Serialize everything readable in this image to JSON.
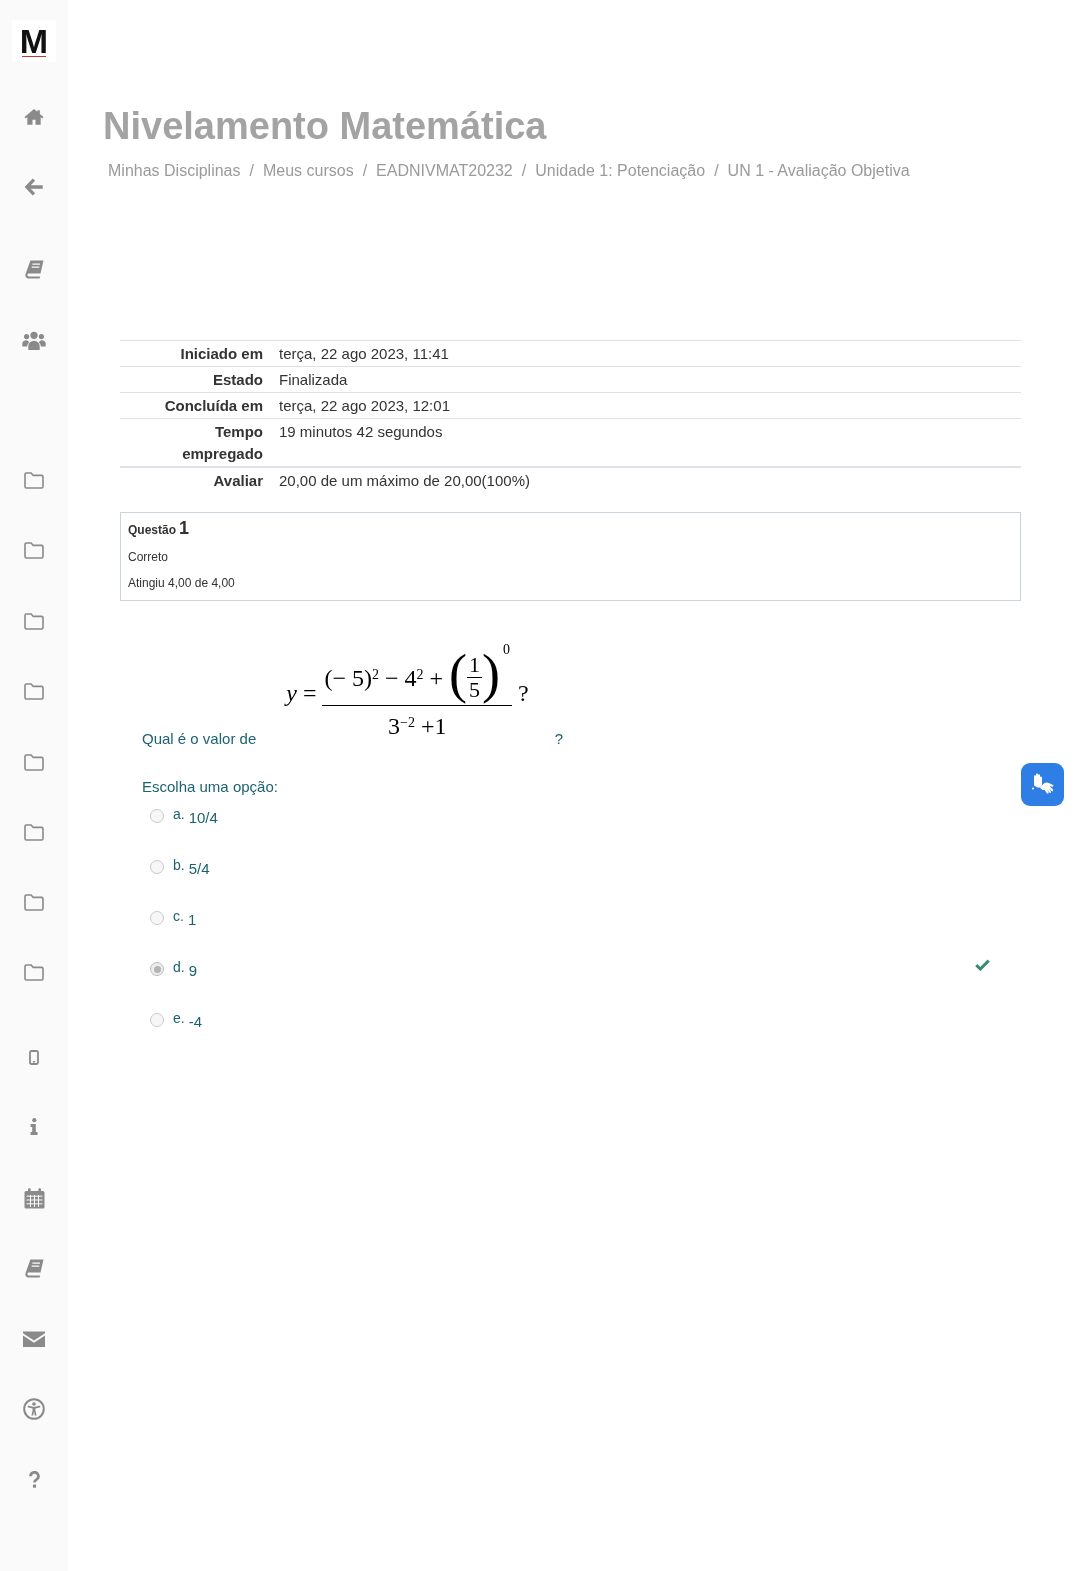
{
  "sidebar": {
    "logo": "M"
  },
  "header": {
    "title": "Nivelamento Matemática",
    "breadcrumb": [
      {
        "label": "Minhas Disciplinas",
        "separator": "/"
      },
      {
        "label": "Meus cursos",
        "separator": "/"
      },
      {
        "label": "EADNIVMAT20232",
        "separator": "/"
      },
      {
        "label": "Unidade 1: Potenciação",
        "separator": "/"
      },
      {
        "label": "UN 1 - Avaliação Objetiva"
      }
    ]
  },
  "summary": [
    {
      "label": "Iniciado em",
      "value": "terça, 22 ago 2023, 11:41"
    },
    {
      "label": "Estado",
      "value": "Finalizada"
    },
    {
      "label": "Concluída em",
      "value": "terça, 22 ago 2023, 12:01"
    },
    {
      "label": "Tempo empregado",
      "value": "19 minutos 42 segundos"
    },
    {
      "label": "Avaliar",
      "value": "20,00 de um máximo de 20,00(100%)"
    }
  ],
  "question_info": {
    "label": "Questão",
    "number": "1",
    "state": "Correto",
    "grade": "Atingiu 4,00 de 4,00"
  },
  "question": {
    "prompt": "Qual é o valor de",
    "formula": {
      "lhs": "*y* =",
      "numerator": "(− 5)$^{2}$ − 4$^{2}$ +",
      "open_paren": "(",
      "inner_numerator": "1",
      "inner_denominator": "5",
      "close_paren": ")",
      "exponent": "0",
      "denominator": "3$^{−2}$ +1",
      "end": "?"
    },
    "prompt_end": "?",
    "instruction": "Escolha uma opção:",
    "options": [
      {
        "letter": "a.",
        "text": "10/4",
        "selected": false,
        "correct": false
      },
      {
        "letter": "b.",
        "text": "5/4",
        "selected": false,
        "correct": false
      },
      {
        "letter": "c.",
        "text": "1",
        "selected": false,
        "correct": false
      },
      {
        "letter": "d.",
        "text": "9",
        "selected": true,
        "correct": true
      },
      {
        "letter": "e.",
        "text": "-4",
        "selected": false,
        "correct": false
      }
    ]
  }
}
